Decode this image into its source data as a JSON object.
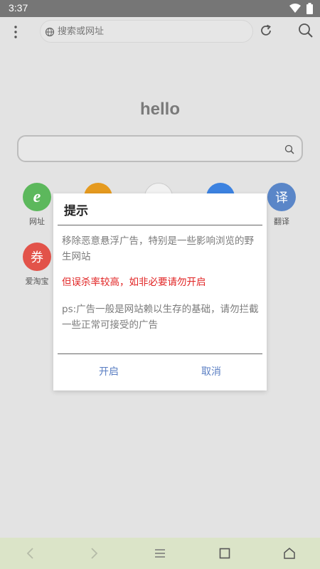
{
  "status": {
    "time": "3:37",
    "icons": [
      "wifi-icon",
      "battery-icon"
    ]
  },
  "toolbar": {
    "menu_icon": "more-vert-icon",
    "address_placeholder": "搜索或网址",
    "refresh_icon": "refresh-icon",
    "search_icon": "search-icon"
  },
  "home": {
    "logo_text": "hello",
    "search_placeholder": ""
  },
  "shortcuts": [
    {
      "label": "网址",
      "glyph": "e",
      "color": "#5cb85c"
    },
    {
      "label": "",
      "glyph": "",
      "color": "#e59a1f"
    },
    {
      "label": "",
      "glyph": "",
      "color": "#f1f1f1"
    },
    {
      "label": "",
      "glyph": "",
      "color": "#3c82e0"
    },
    {
      "label": "翻译",
      "glyph": "译",
      "color": "#5a86c8"
    },
    {
      "label": "爱淘宝",
      "glyph": "券",
      "color": "#e2534a"
    }
  ],
  "dialog": {
    "title": "提示",
    "message": "移除恶意悬浮广告，特别是一些影响浏览的野生网站",
    "warning": "但误杀率较高，如非必要请勿开启",
    "note": "ps:广告一般是网站赖以生存的基础，请勿拦截一些正常可接受的广告",
    "ok_label": "开启",
    "cancel_label": "取消"
  },
  "colors": {
    "warning": "#e12323",
    "button": "#5b7fc3",
    "navbar": "#dbe4c8"
  },
  "navbar": [
    "back-icon",
    "forward-icon",
    "menu-icon",
    "tabs-icon",
    "home-icon"
  ]
}
